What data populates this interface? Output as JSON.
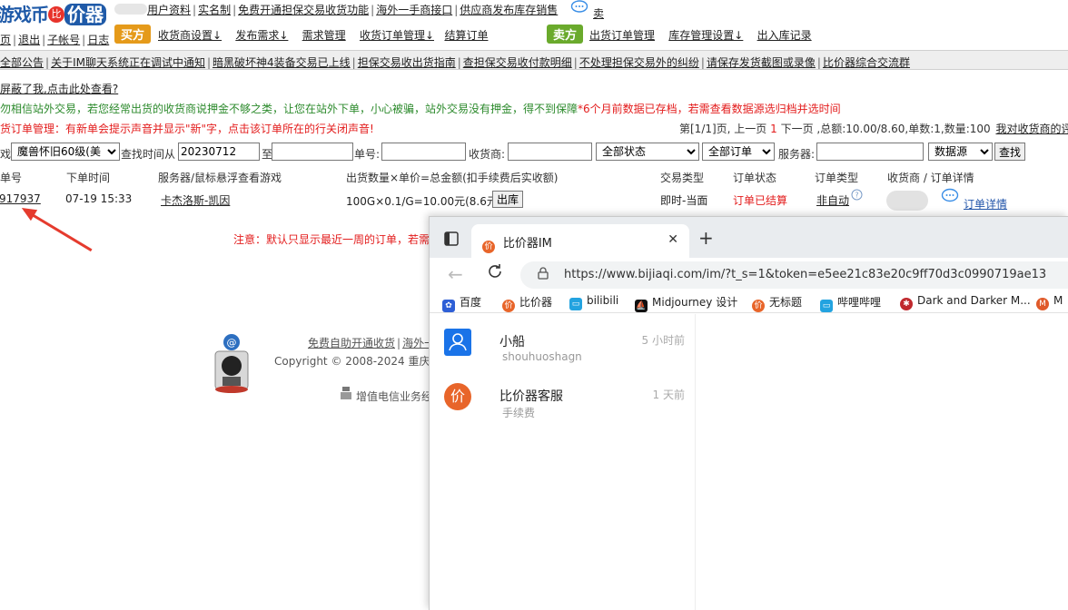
{
  "header": {
    "logo_text": "游戏币",
    "logo_badge": "比",
    "logo_text2": "价器",
    "row1": [
      "用户资料",
      "实名制",
      "免费开通担保交易收货功能",
      "海外一手商接口",
      "供应商发布库存销售"
    ],
    "row1_trailing": "卖",
    "row2_left": [
      "页",
      "退出",
      "子帐号",
      "日志"
    ],
    "buy_tag": "买方",
    "buy_menu": [
      "收货商设置↓",
      "发布需求↓",
      "需求管理",
      "收货订单管理↓",
      "结算订单"
    ],
    "sell_tag": "卖方",
    "sell_menu": [
      "出货订单管理",
      "库存管理设置↓",
      "出入库记录"
    ]
  },
  "notices": [
    "全部公告",
    "关于IM聊天系统正在调试中通知",
    "暗黑破坏神4装备交易已上线",
    "担保交易收出货指南",
    "查担保交易收付款明细",
    "不处理担保交易外的纠纷",
    "请保存发货截图或录像",
    "比价器综合交流群"
  ],
  "info": {
    "shield_link": "屏蔽了我,点击此处查看?",
    "green_warning": "勿相信站外交易，若您经常出货的收货商说押金不够之类，让您在站外下单，小心被骗，站外交易没有押金，得不到保障",
    "red_warning": "*6个月前数据已存档，若需查看数据源选归档并选时间",
    "red_notice": "货订单管理：有新单会提示声音并显示\"新\"字，点击该订单所在的行关闭声音!",
    "pager_prefix": "第[1/1]页, 上一页",
    "pager_current": "1",
    "pager_suffix": "下一页 ,总额:10.00/8.60,单数:1,数量:100",
    "pager_link": "我对收货商的评价"
  },
  "filters": {
    "game_label": "戏:",
    "game_value": "魔兽怀旧60级(美",
    "time_label": "查找时间从",
    "time_from": "20230712",
    "time_to_label": "至",
    "order_label": "单号:",
    "buyer_label": "收货商:",
    "status_value": "全部状态",
    "order_type_value": "全部订单",
    "server_label": "服务器:",
    "source_value": "数据源",
    "search_button": "查找"
  },
  "table": {
    "headers": [
      "单号",
      "下单时间",
      "服务器/鼠标悬浮查看游戏",
      "出货数量×单价=总金额(扣手续费后实收额)",
      "交易类型",
      "订单状态",
      "订单类型",
      "收货商 / 订单详情"
    ],
    "row": {
      "order_no": "917937",
      "time": "07-19 15:33",
      "server": "卡杰洛斯-凯因",
      "amount": "100G×0.1/G=10.00元(8.6元)",
      "ship_button": "出库",
      "trade_type": "即时-当面",
      "status": "订单已结算",
      "order_type": "非自动",
      "detail_link": "订单详情"
    },
    "note": "注意：默认只显示最近一周的订单，若需"
  },
  "footer": {
    "links": [
      "免费自助开通收货",
      "海外一"
    ],
    "copyright": "Copyright © 2008-2024 重庆",
    "icp": "增值电信业务经"
  },
  "browser": {
    "tab_title": "比价器IM",
    "url": "https://www.bijiaqi.com/im/?t_s=1&token=e5ee21c83e20c9ff70d3c0990719ae13",
    "bookmarks": [
      "百度",
      "比价器",
      "bilibili",
      "Midjourney 设计",
      "无标题",
      "哔哩哔哩",
      "Dark and Darker M...",
      "M"
    ],
    "chats": [
      {
        "name": "小船",
        "sub": "shouhuoshagn",
        "time": "5 小时前"
      },
      {
        "name": "比价器客服",
        "sub": "手续费",
        "time": "1 天前"
      }
    ]
  },
  "colors": {
    "accent_red": "#e31c1c",
    "accent_green": "#2c8a2c",
    "buy_tag": "#e59a1a",
    "sell_tag": "#6aaa2c",
    "arrow": "#e53b2e"
  }
}
